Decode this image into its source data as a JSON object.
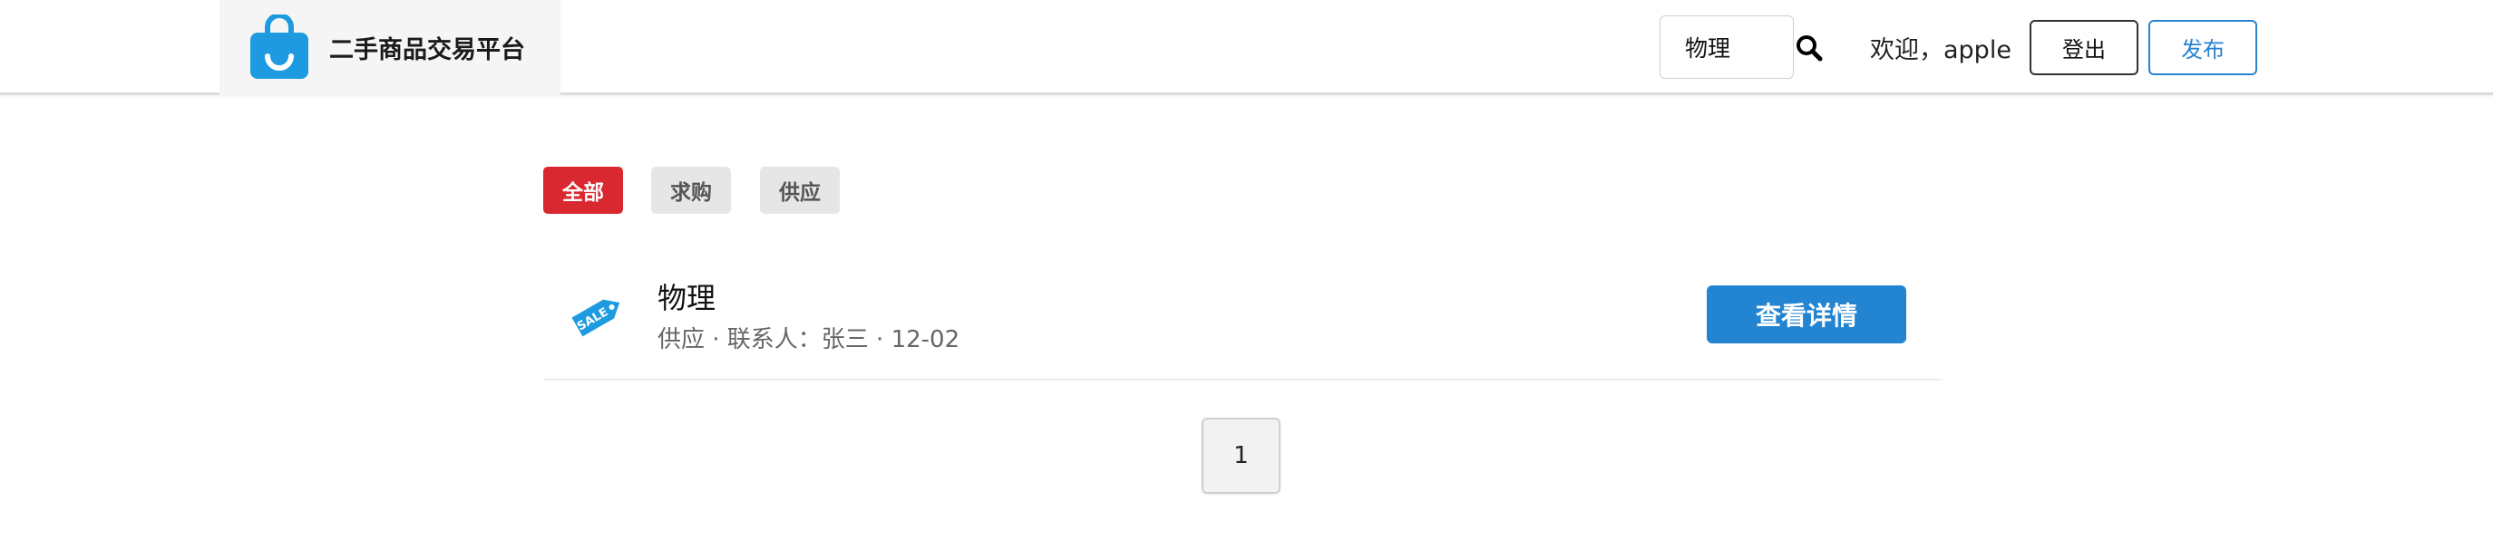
{
  "header": {
    "brand_title": "二手商品交易平台",
    "search": {
      "value": "物理",
      "placeholder": ""
    },
    "welcome_text": "欢迎，apple",
    "logout_label": "登出",
    "publish_label": "发布"
  },
  "filters": [
    {
      "label": "全部",
      "active": true
    },
    {
      "label": "求购",
      "active": false
    },
    {
      "label": "供应",
      "active": false
    }
  ],
  "listings": [
    {
      "icon": "sale-tag-icon",
      "title": "物理",
      "meta": "供应 · 联系人：张三 · 12-02",
      "action_label": "查看详情"
    }
  ],
  "pagination": {
    "pages": [
      "1"
    ],
    "current": "1"
  },
  "colors": {
    "accent_blue": "#2385d1",
    "active_red": "#d9282f",
    "brand_blue": "#1e9be0"
  }
}
